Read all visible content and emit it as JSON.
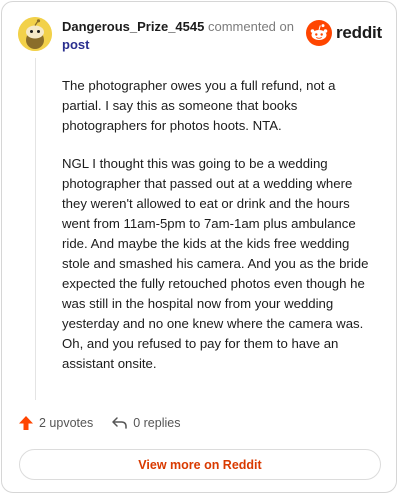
{
  "comment": {
    "username": "Dangerous_Prize_4545",
    "action_text": "commented on",
    "post_link": "post",
    "paragraphs": [
      "The photographer owes you a full refund, not a partial. I say this as someone that books photographers for photos hoots. NTA.",
      "NGL I thought this was going to be a wedding photographer that passed out at a wedding where they weren't allowed to eat or drink and the hours went from 11am-5pm to 7am-1am plus ambulance ride. And maybe the kids at the kids free wedding stole and smashed his camera. And you as the bride expected the fully retouched photos even though he was still in the hospital now from your wedding yesterday and no one knew where the camera was. Oh, and you refused to pay for them to have an assistant onsite."
    ],
    "upvotes_label": "2 upvotes",
    "replies_label": "0 replies"
  },
  "brand": {
    "name": "reddit",
    "color": "#ff4500"
  },
  "footer": {
    "view_more_label": "View more on Reddit"
  },
  "icons": {
    "avatar": "snoo-avatar-icon",
    "logo": "reddit-logo-icon",
    "upvote": "upvote-arrow-icon",
    "reply": "reply-arrow-icon"
  },
  "colors": {
    "upvote": "#ff4500",
    "link": "#2a2f8f",
    "view_more_text": "#d93a00",
    "avatar_bg": "#f2d14a"
  }
}
